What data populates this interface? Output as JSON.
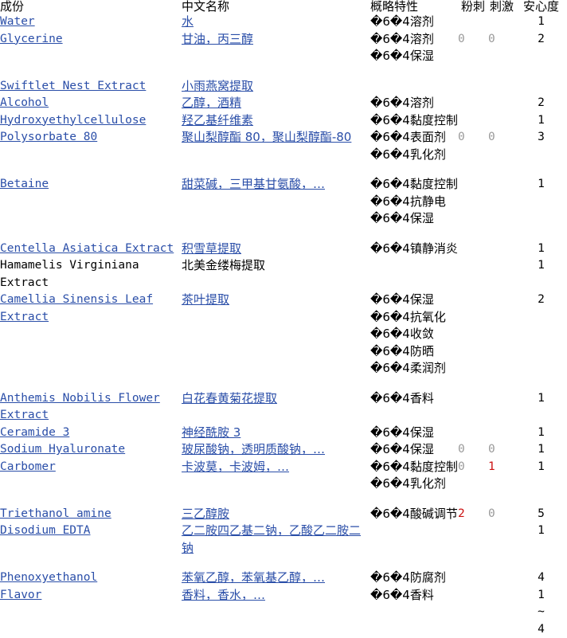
{
  "table": {
    "headers": {
      "ingredient": "成份",
      "chinese_name": "中文名称",
      "properties": "概略特性",
      "acne": "粉刺",
      "irritation": "刺激",
      "safety": "安心度"
    },
    "mojibake_prefix": "�6�4",
    "colors": {
      "link": "#2a4ea8",
      "text": "#000000",
      "muted_number": "#9a9a9a",
      "warn_number": "#cc1111",
      "background": "#ffffff"
    },
    "rows": [
      {
        "ingredient": "Water",
        "ingredient_is_link": true,
        "chinese_name": "水",
        "chinese_is_link": true,
        "properties": [
          "溶剂"
        ],
        "acne": "",
        "irritation": "",
        "safety": "1",
        "acne_warn": false,
        "irritation_warn": false,
        "gap_after": false
      },
      {
        "ingredient": "Glycerine",
        "ingredient_is_link": true,
        "chinese_name": "甘油，丙三醇",
        "chinese_is_link": true,
        "properties": [
          "溶剂",
          "保湿"
        ],
        "acne": "0",
        "irritation": "0",
        "safety": "2",
        "acne_warn": false,
        "irritation_warn": false,
        "gap_after": true
      },
      {
        "ingredient": "Swiftlet Nest Extract",
        "ingredient_is_link": true,
        "chinese_name": "小雨燕窝提取",
        "chinese_is_link": true,
        "properties": [],
        "acne": "",
        "irritation": "",
        "safety": "",
        "acne_warn": false,
        "irritation_warn": false,
        "gap_after": false
      },
      {
        "ingredient": "Alcohol",
        "ingredient_is_link": true,
        "chinese_name": "乙醇，酒精",
        "chinese_is_link": true,
        "properties": [
          "溶剂"
        ],
        "acne": "",
        "irritation": "",
        "safety": "2",
        "acne_warn": false,
        "irritation_warn": false,
        "gap_after": false
      },
      {
        "ingredient": "Hydroxyethylcellulose",
        "ingredient_is_link": true,
        "chinese_name": "羟乙基纤维素",
        "chinese_is_link": true,
        "properties": [
          "黏度控制"
        ],
        "acne": "",
        "irritation": "",
        "safety": "1",
        "acne_warn": false,
        "irritation_warn": false,
        "gap_after": false
      },
      {
        "ingredient": "Polysorbate 80",
        "ingredient_is_link": true,
        "chinese_name": "聚山梨醇酯 80，聚山梨醇酯-80",
        "chinese_is_link": true,
        "properties": [
          "表面剂",
          "乳化剂"
        ],
        "acne": "0",
        "irritation": "0",
        "safety": "3",
        "acne_warn": false,
        "irritation_warn": false,
        "gap_after": true
      },
      {
        "ingredient": "Betaine",
        "ingredient_is_link": true,
        "chinese_name": "甜菜碱，三甲基甘氨酸，…",
        "chinese_is_link": true,
        "properties": [
          "黏度控制",
          "抗静电",
          "保湿"
        ],
        "acne": "",
        "irritation": "",
        "safety": "1",
        "acne_warn": false,
        "irritation_warn": false,
        "gap_after": true
      },
      {
        "ingredient": "Centella Asiatica Extract",
        "ingredient_is_link": true,
        "chinese_name": "积雪草提取",
        "chinese_is_link": true,
        "properties": [
          "镇静消炎"
        ],
        "acne": "",
        "irritation": "",
        "safety": "1",
        "acne_warn": false,
        "irritation_warn": false,
        "gap_after": false
      },
      {
        "ingredient": "Hamamelis Virginiana Extract",
        "ingredient_is_link": false,
        "chinese_name": "北美金缕梅提取",
        "chinese_is_link": false,
        "properties": [],
        "acne": "",
        "irritation": "",
        "safety": "1",
        "acne_warn": false,
        "irritation_warn": false,
        "gap_after": false
      },
      {
        "ingredient": "Camellia Sinensis Leaf Extract",
        "ingredient_is_link": true,
        "chinese_name": "茶叶提取",
        "chinese_is_link": true,
        "properties": [
          "保湿",
          "抗氧化",
          "收敛",
          "防晒",
          "柔润剂"
        ],
        "acne": "",
        "irritation": "",
        "safety": "2",
        "acne_warn": false,
        "irritation_warn": false,
        "gap_after": true
      },
      {
        "ingredient": "Anthemis Nobilis Flower Extract",
        "ingredient_is_link": true,
        "chinese_name": "白花春黄菊花提取",
        "chinese_is_link": true,
        "properties": [
          "香料"
        ],
        "acne": "",
        "irritation": "",
        "safety": "1",
        "acne_warn": false,
        "irritation_warn": false,
        "gap_after": false
      },
      {
        "ingredient": "Ceramide 3",
        "ingredient_is_link": true,
        "chinese_name": "神经酰胺 3",
        "chinese_is_link": true,
        "properties": [
          "保湿"
        ],
        "acne": "",
        "irritation": "",
        "safety": "1",
        "acne_warn": false,
        "irritation_warn": false,
        "gap_after": false
      },
      {
        "ingredient": "Sodium Hyaluronate",
        "ingredient_is_link": true,
        "chinese_name": "玻尿酸钠，透明质酸钠，…",
        "chinese_is_link": true,
        "properties": [
          "保湿"
        ],
        "acne": "0",
        "irritation": "0",
        "safety": "1",
        "acne_warn": false,
        "irritation_warn": false,
        "gap_after": false
      },
      {
        "ingredient": "Carbomer",
        "ingredient_is_link": true,
        "chinese_name": "卡波莫，卡波姆，…",
        "chinese_is_link": true,
        "properties": [
          "黏度控制",
          "乳化剂"
        ],
        "acne": "0",
        "irritation": "1",
        "safety": "1",
        "acne_warn": false,
        "irritation_warn": true,
        "gap_after": true
      },
      {
        "ingredient": "Triethanol amine",
        "ingredient_is_link": true,
        "chinese_name": "三乙醇胺",
        "chinese_is_link": true,
        "properties": [
          "酸碱调节"
        ],
        "acne": "2",
        "irritation": "0",
        "safety": "5",
        "acne_warn": true,
        "irritation_warn": false,
        "gap_after": false
      },
      {
        "ingredient": "Disodium EDTA",
        "ingredient_is_link": true,
        "chinese_name": "乙二胺四乙基二钠，乙酸乙二胺二钠",
        "chinese_is_link": true,
        "properties": [],
        "acne": "",
        "irritation": "",
        "safety": "1",
        "acne_warn": false,
        "irritation_warn": false,
        "gap_after": true
      },
      {
        "ingredient": "Phenoxyethanol",
        "ingredient_is_link": true,
        "chinese_name": "苯氧乙醇，苯氧基乙醇，…",
        "chinese_is_link": true,
        "properties": [
          "防腐剂"
        ],
        "acne": "",
        "irritation": "",
        "safety": "4",
        "acne_warn": false,
        "irritation_warn": false,
        "gap_after": false
      },
      {
        "ingredient": "Flavor",
        "ingredient_is_link": true,
        "chinese_name": "香料，香水，…",
        "chinese_is_link": true,
        "properties": [
          "香料"
        ],
        "acne": "",
        "irritation": "",
        "safety": "1~4",
        "acne_warn": false,
        "irritation_warn": false,
        "gap_after": false
      }
    ]
  }
}
